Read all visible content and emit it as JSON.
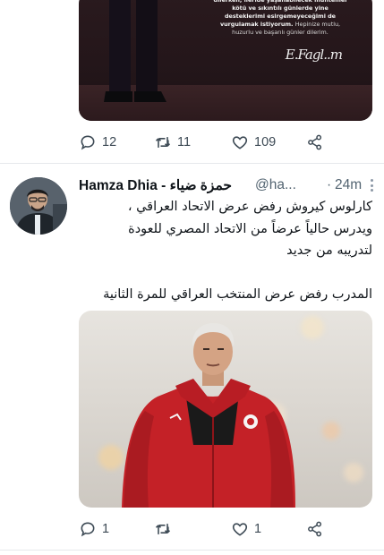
{
  "tweet1": {
    "media": {
      "text_bold": "dilerken, ileride yaşanabilecek muhtemel kötü ve sıkıntılı günlerde yine desteklerimi esirgemeyeceğimi de vurgulamak istiyorum.",
      "text_light": "Hepinize mutlu, huzurlu ve başarılı günler dilerim.",
      "signature": "E.Fagl..m"
    },
    "actions": {
      "replies": "12",
      "retweets": "11",
      "likes": "109"
    }
  },
  "tweet2": {
    "author_name": "Hamza Dhia - حمزة ضياء",
    "handle": "@ha...",
    "dot": "·",
    "time": "24m",
    "text_lines": [
      "كارلوس كيروش رفض عرض الاتحاد العراقي ،",
      "ويدرس حالياً عرضاً من الاتحاد المصري للعودة",
      "لتدريبه من جديد",
      "المدرب رفض عرض المنتخب العراقي للمرة الثانية"
    ],
    "actions": {
      "replies": "1",
      "retweets": "",
      "likes": "1"
    }
  },
  "colors": {
    "text": "#0f1419",
    "secondary": "#536471",
    "icon": "#3d4a55",
    "divider": "#e6e9ec"
  }
}
